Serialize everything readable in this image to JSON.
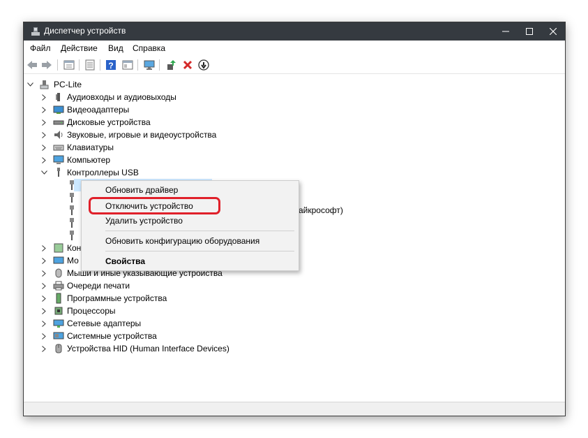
{
  "window": {
    "title": "Диспетчер устройств"
  },
  "menu": [
    "Файл",
    "Действие",
    "Вид",
    "Справка"
  ],
  "toolbar_icons": [
    "back-arrow-icon",
    "forward-arrow-icon",
    "properties-icon",
    "update-icon",
    "help-icon",
    "view-icon",
    "monitor-icon",
    "driver-update-icon",
    "remove-icon",
    "disable-icon"
  ],
  "tree": {
    "root": "PC-Lite",
    "categories": [
      {
        "label": "Аудиовходы и аудиовыходы",
        "icon": "audio-icon"
      },
      {
        "label": "Видеоадаптеры",
        "icon": "display-adapter-icon"
      },
      {
        "label": "Дисковые устройства",
        "icon": "disk-icon"
      },
      {
        "label": "Звуковые, игровые и видеоустройства",
        "icon": "sound-icon"
      },
      {
        "label": "Клавиатуры",
        "icon": "keyboard-icon"
      },
      {
        "label": "Компьютер",
        "icon": "computer-icon"
      },
      {
        "label": "Контроллеры USB",
        "icon": "usb-icon"
      }
    ],
    "usb_children_partial": "айкрософт)",
    "partial_categories": [
      {
        "label": "Кон",
        "icon": "components-icon"
      },
      {
        "label": "Мо",
        "icon": "monitor-icon"
      }
    ],
    "categories_after": [
      {
        "label": "Мыши и иные указывающие устройства",
        "icon": "mouse-icon"
      },
      {
        "label": "Очереди печати",
        "icon": "printer-icon"
      },
      {
        "label": "Программные устройства",
        "icon": "software-device-icon"
      },
      {
        "label": "Процессоры",
        "icon": "cpu-icon"
      },
      {
        "label": "Сетевые адаптеры",
        "icon": "network-icon"
      },
      {
        "label": "Системные устройства",
        "icon": "system-icon"
      },
      {
        "label": "Устройства HID (Human Interface Devices)",
        "icon": "hid-icon"
      }
    ]
  },
  "context_menu": {
    "items": [
      "Обновить драйвер",
      "Отключить устройство",
      "Удалить устройство",
      "Обновить конфигурацию оборудования",
      "Свойства"
    ]
  },
  "colors": {
    "titlebar": "#353a40",
    "highlight": "#e0202a",
    "selection": "#cce8ff"
  }
}
